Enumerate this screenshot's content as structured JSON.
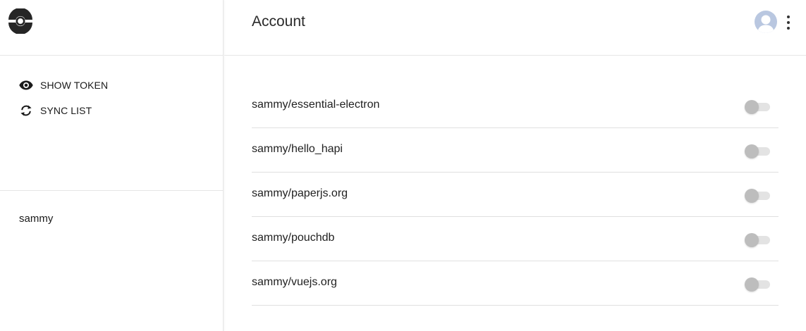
{
  "sidebar": {
    "logo_icon": "pokeball-logo-icon",
    "menu": [
      {
        "label": "SHOW TOKEN",
        "icon": "eye-icon"
      },
      {
        "label": "SYNC LIST",
        "icon": "sync-icon"
      }
    ],
    "user": "sammy"
  },
  "header": {
    "title": "Account",
    "avatar_icon": "avatar",
    "menu_icon": "more-vert-icon"
  },
  "repos": [
    {
      "name": "sammy/essential-electron",
      "enabled": false
    },
    {
      "name": "sammy/hello_hapi",
      "enabled": false
    },
    {
      "name": "sammy/paperjs.org",
      "enabled": false
    },
    {
      "name": "sammy/pouchdb",
      "enabled": false
    },
    {
      "name": "sammy/vuejs.org",
      "enabled": false
    }
  ],
  "colors": {
    "divider": "#e6e6e6",
    "toggle_thumb_off": "#bdbdbd",
    "toggle_track_off": "#e3e3e3",
    "avatar_bg": "#b9c7e0"
  }
}
